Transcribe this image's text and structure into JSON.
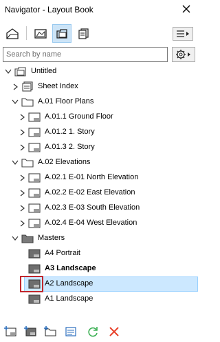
{
  "window": {
    "title": "Navigator - Layout Book"
  },
  "search": {
    "placeholder": "Search by name"
  },
  "tree": {
    "root": "Untitled",
    "sheet_index": "Sheet Index",
    "floor_plans": {
      "label": "A.01 Floor Plans",
      "items": [
        "A.01.1 Ground Floor",
        "A.01.2 1. Story",
        "A.01.3 2. Story"
      ]
    },
    "elevations": {
      "label": "A.02 Elevations",
      "items": [
        "A.02.1 E-01 North Elevation",
        "A.02.2 E-02 East Elevation",
        "A.02.3 E-03 South Elevation",
        "A.02.4 E-04 West Elevation"
      ]
    },
    "masters": {
      "label": "Masters",
      "items": [
        "A4 Portrait",
        "A3 Landscape",
        "A2 Landscape",
        "A1 Landscape"
      ]
    }
  },
  "colors": {
    "selection": "#cce8ff",
    "active_tool": "#cce4f7",
    "highlight_box": "#c0262d",
    "delete_icon": "#e8432c",
    "refresh_icon": "#3cb054"
  }
}
